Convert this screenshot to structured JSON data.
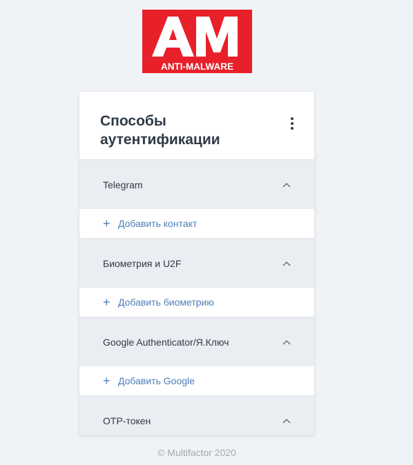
{
  "logo": {
    "letters": "AM",
    "subtitle": "ANTI-MALWARE",
    "color": "#e8202a"
  },
  "card": {
    "title": "Способы аутентификации",
    "menu_icon": "kebab-menu-icon"
  },
  "sections": [
    {
      "label": "Telegram",
      "action": "Добавить контакт"
    },
    {
      "label": "Биометрия и U2F",
      "action": "Добавить биометрию"
    },
    {
      "label": "Google Authenticator/Я.Ключ",
      "action": "Добавить Google"
    },
    {
      "label": "OTP-токен"
    }
  ],
  "footer": {
    "text": "© Multifactor 2020"
  },
  "colors": {
    "background": "#f0f3f6",
    "section_bg": "#eaedf1",
    "link": "#4d7fb8",
    "text": "#2f3a45"
  }
}
